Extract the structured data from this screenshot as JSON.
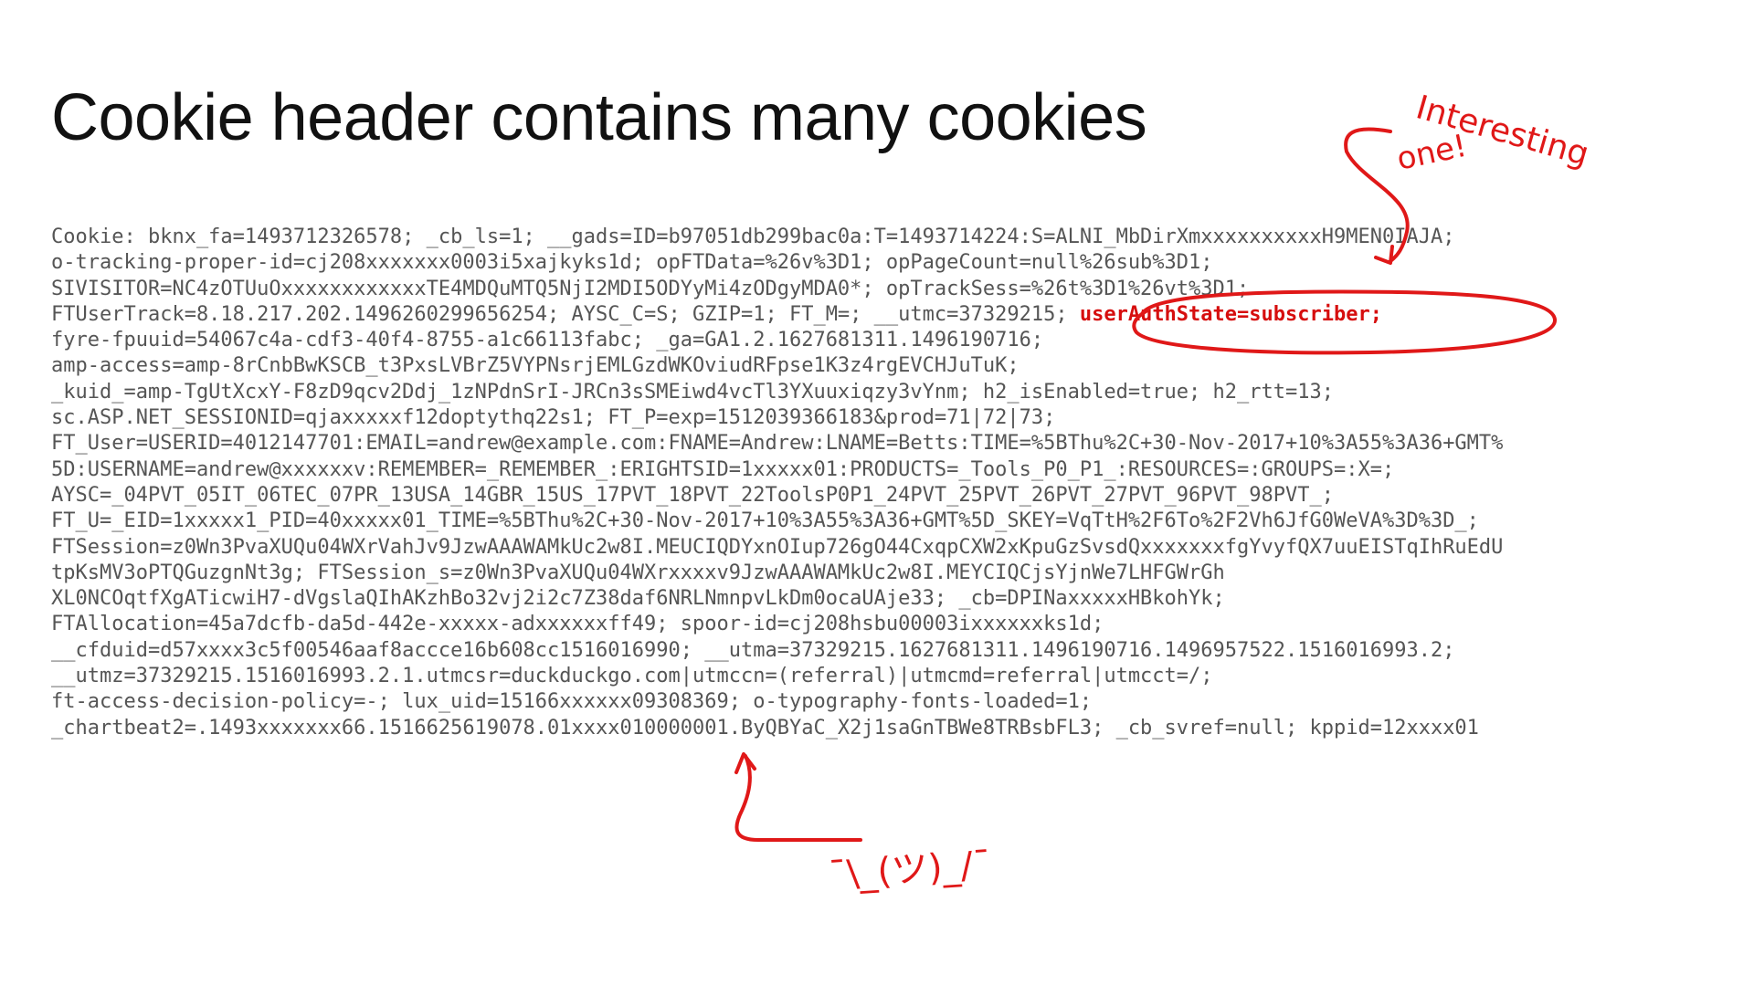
{
  "title": "Cookie header contains many cookies",
  "cookie_lines": [
    "Cookie: bknx_fa=1493712326578; _cb_ls=1; __gads=ID=b97051db299bac0a:T=1493714224:S=ALNI_MbDirXmxxxxxxxxxxH9MEN0IAJA;",
    "o-tracking-proper-id=cj208xxxxxxx0003i5xajkyks1d; opFTData=%26v%3D1; opPageCount=null%26sub%3D1;",
    "SIVISITOR=NC4zOTUuOxxxxxxxxxxxxTE4MDQuMTQ5NjI2MDI5ODYyMi4zODgyMDA0*; opTrackSess=%26t%3D1%26vt%3D1;",
    "FTUserTrack=8.18.217.202.1496260299656254; AYSC_C=S; GZIP=1; FT_M=; __utmc=37329215;",
    "fyre-fpuuid=54067c4a-cdf3-40f4-8755-a1c66113fabc; _ga=GA1.2.1627681311.1496190716;",
    "amp-access=amp-8rCnbBwKSCB_t3PxsLVBrZ5VYPNsrjEMLGzdWKOviudRFpse1K3z4rgEVCHJuTuK;",
    "_kuid_=amp-TgUtXcxY-F8zD9qcv2Ddj_1zNPdnSrI-JRCn3sSMEiwd4vcTl3YXuuxiqzy3vYnm; h2_isEnabled=true; h2_rtt=13;",
    "sc.ASP.NET_SESSIONID=qjaxxxxxf12doptythq22s1; FT_P=exp=1512039366183&prod=71|72|73;",
    "FT_User=USERID=4012147701:EMAIL=andrew@example.com:FNAME=Andrew:LNAME=Betts:TIME=%5BThu%2C+30-Nov-2017+10%3A55%3A36+GMT%",
    "5D:USERNAME=andrew@xxxxxxv:REMEMBER=_REMEMBER_:ERIGHTSID=1xxxxx01:PRODUCTS=_Tools_P0_P1_:RESOURCES=:GROUPS=:X=;",
    "AYSC=_04PVT_05IT_06TEC_07PR_13USA_14GBR_15US_17PVT_18PVT_22ToolsP0P1_24PVT_25PVT_26PVT_27PVT_96PVT_98PVT_;",
    "FT_U=_EID=1xxxxx1_PID=40xxxxx01_TIME=%5BThu%2C+30-Nov-2017+10%3A55%3A36+GMT%5D_SKEY=VqTtH%2F6To%2F2Vh6JfG0WeVA%3D%3D_;",
    "FTSession=z0Wn3PvaXUQu04WXrVahJv9JzwAAAWAMkUc2w8I.MEUCIQDYxnOIup726gO44CxqpCXW2xKpuGzSvsdQxxxxxxxfgYvyfQX7uuEISTqIhRuEdU",
    "tpKsMV3oPTQGuzgnNt3g; FTSession_s=z0Wn3PvaXUQu04WXrxxxxv9JzwAAAWAMkUc2w8I.MEYCIQCjsYjnWe7LHFGWrGh",
    "XL0NCOqtfXgATicwiH7-dVgslaQIhAKzhBo32vj2i2c7Z38daf6NRLNmnpvLkDm0ocaUAje33; _cb=DPINaxxxxxHBkohYk;",
    "FTAllocation=45a7dcfb-da5d-442e-xxxxx-adxxxxxxff49; spoor-id=cj208hsbu00003ixxxxxxks1d;",
    "__cfduid=d57xxxx3c5f00546aaf8accce16b608cc1516016990; __utma=37329215.1627681311.1496190716.1496957522.1516016993.2;",
    "__utmz=37329215.1516016993.2.1.utmcsr=duckduckgo.com|utmccn=(referral)|utmcmd=referral|utmcct=/;",
    "ft-access-decision-policy=-; lux_uid=15166xxxxxx09308369; o-typography-fonts-loaded=1;",
    "_chartbeat2=.1493xxxxxxx66.1516625619078.01xxxx010000001.ByQBYaC_X2j1saGnTBWe8TRBsbFL3; _cb_svref=null; kppid=12xxxx01"
  ],
  "highlighted_cookie": "userAuthState=subscriber;",
  "annotations": {
    "callout_top_line1": "Interesting",
    "callout_top_line2": "one!",
    "callout_bottom": "¯\\_(ツ)_/¯"
  },
  "colors": {
    "title": "#111111",
    "code_text": "#555555",
    "annotation": "#e01818",
    "highlight": "#d60e0e"
  }
}
